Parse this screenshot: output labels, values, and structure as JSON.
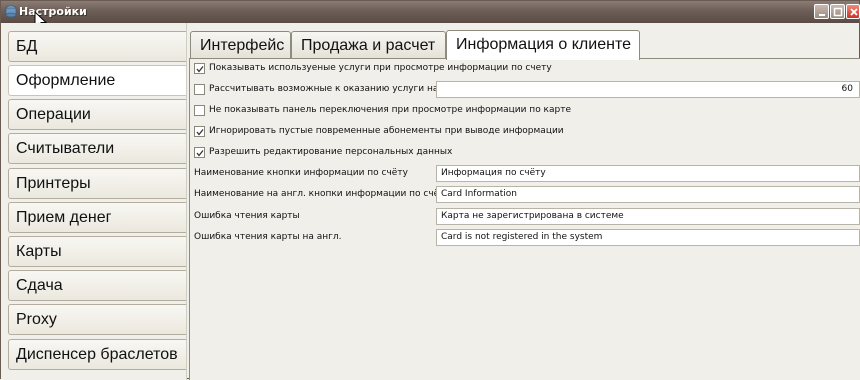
{
  "window": {
    "title": "Настройки"
  },
  "sidebar": {
    "items": [
      {
        "label": "БД"
      },
      {
        "label": "Оформление"
      },
      {
        "label": "Операции"
      },
      {
        "label": "Считыватели"
      },
      {
        "label": "Принтеры"
      },
      {
        "label": "Прием денег"
      },
      {
        "label": "Карты"
      },
      {
        "label": "Сдача"
      },
      {
        "label": "Proxy"
      },
      {
        "label": "Диспенсер браслетов"
      }
    ],
    "active_index": 1
  },
  "tabs": [
    {
      "label": "Интерфейс"
    },
    {
      "label": "Продажа и расчет"
    },
    {
      "label": "Информация о клиенте"
    }
  ],
  "active_tab": 2,
  "options": {
    "show_used_services": {
      "label": "Показывать используеные услуги при просмотре информации по счету",
      "checked": true
    },
    "calc_possible_services": {
      "label": "Рассчитывать возможные к оказанию услуги на",
      "checked": false,
      "value": "60"
    },
    "hide_switch_panel": {
      "label": "Не показывать панель переключения при просмотре информации по карте",
      "checked": false
    },
    "ignore_empty_subscriptions": {
      "label": "Игнорировать пустые повременные абонементы при выводе информации",
      "checked": true
    },
    "allow_edit_personal": {
      "label": "Разрешить редактирование персональных данных",
      "checked": true
    }
  },
  "fields": {
    "info_button_name": {
      "label": "Наименование кнопки информации по счёту",
      "value": "Информация по счёту"
    },
    "info_button_name_en": {
      "label": "Наименование на англ.  кнопки информации по счёту",
      "value": "Card Information"
    },
    "card_read_error": {
      "label": "Ошибка чтения карты",
      "value": "Карта не зарегистрирована в системе"
    },
    "card_read_error_en": {
      "label": "Ошибка чтения карты на англ.",
      "value": "Card is not registered in the system"
    }
  }
}
